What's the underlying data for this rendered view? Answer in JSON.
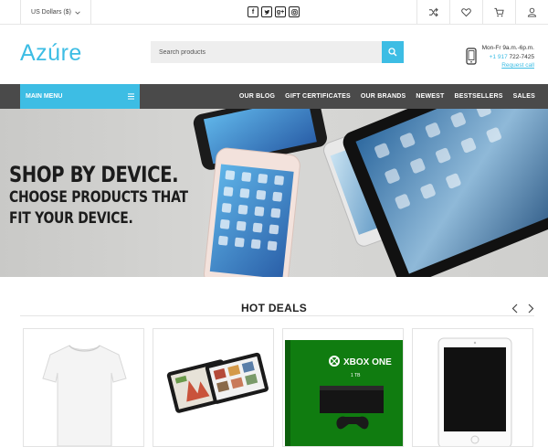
{
  "topbar": {
    "currency_label": "US Dollars ($)",
    "social": [
      "f",
      "t",
      "g+",
      "ig"
    ],
    "icons": [
      "shuffle-icon",
      "heart-icon",
      "cart-icon",
      "user-icon"
    ]
  },
  "header": {
    "logo": "Azúre",
    "search_placeholder": "Search products",
    "hours": "Mon-Fr 9a.m.-6p.m.",
    "phone_prefix": "+1 917 ",
    "phone_number": "722-7425",
    "request_call": "Request call"
  },
  "nav": {
    "main_menu": "MAIN MENU",
    "links": [
      "OUR BLOG",
      "GIFT CERTIFICATES",
      "OUR BRANDS",
      "NEWEST",
      "BESTSELLERS",
      "SALES"
    ]
  },
  "banner": {
    "line1": "SHOP BY DEVICE.",
    "line2": "CHOOSE PRODUCTS THAT",
    "line3": "FIT YOUR DEVICE."
  },
  "deals": {
    "title": "HOT DEALS",
    "products": [
      {
        "image": "white-tshirt"
      },
      {
        "image": "two-tablets"
      },
      {
        "image": "xbox-one-box",
        "box_label": "XBOX ONE",
        "box_sub": "1 TB"
      },
      {
        "image": "white-ipad"
      }
    ]
  },
  "colors": {
    "accent": "#3dbde4",
    "nav_bg": "#4a4a4a",
    "xbox_green": "#107c10"
  }
}
